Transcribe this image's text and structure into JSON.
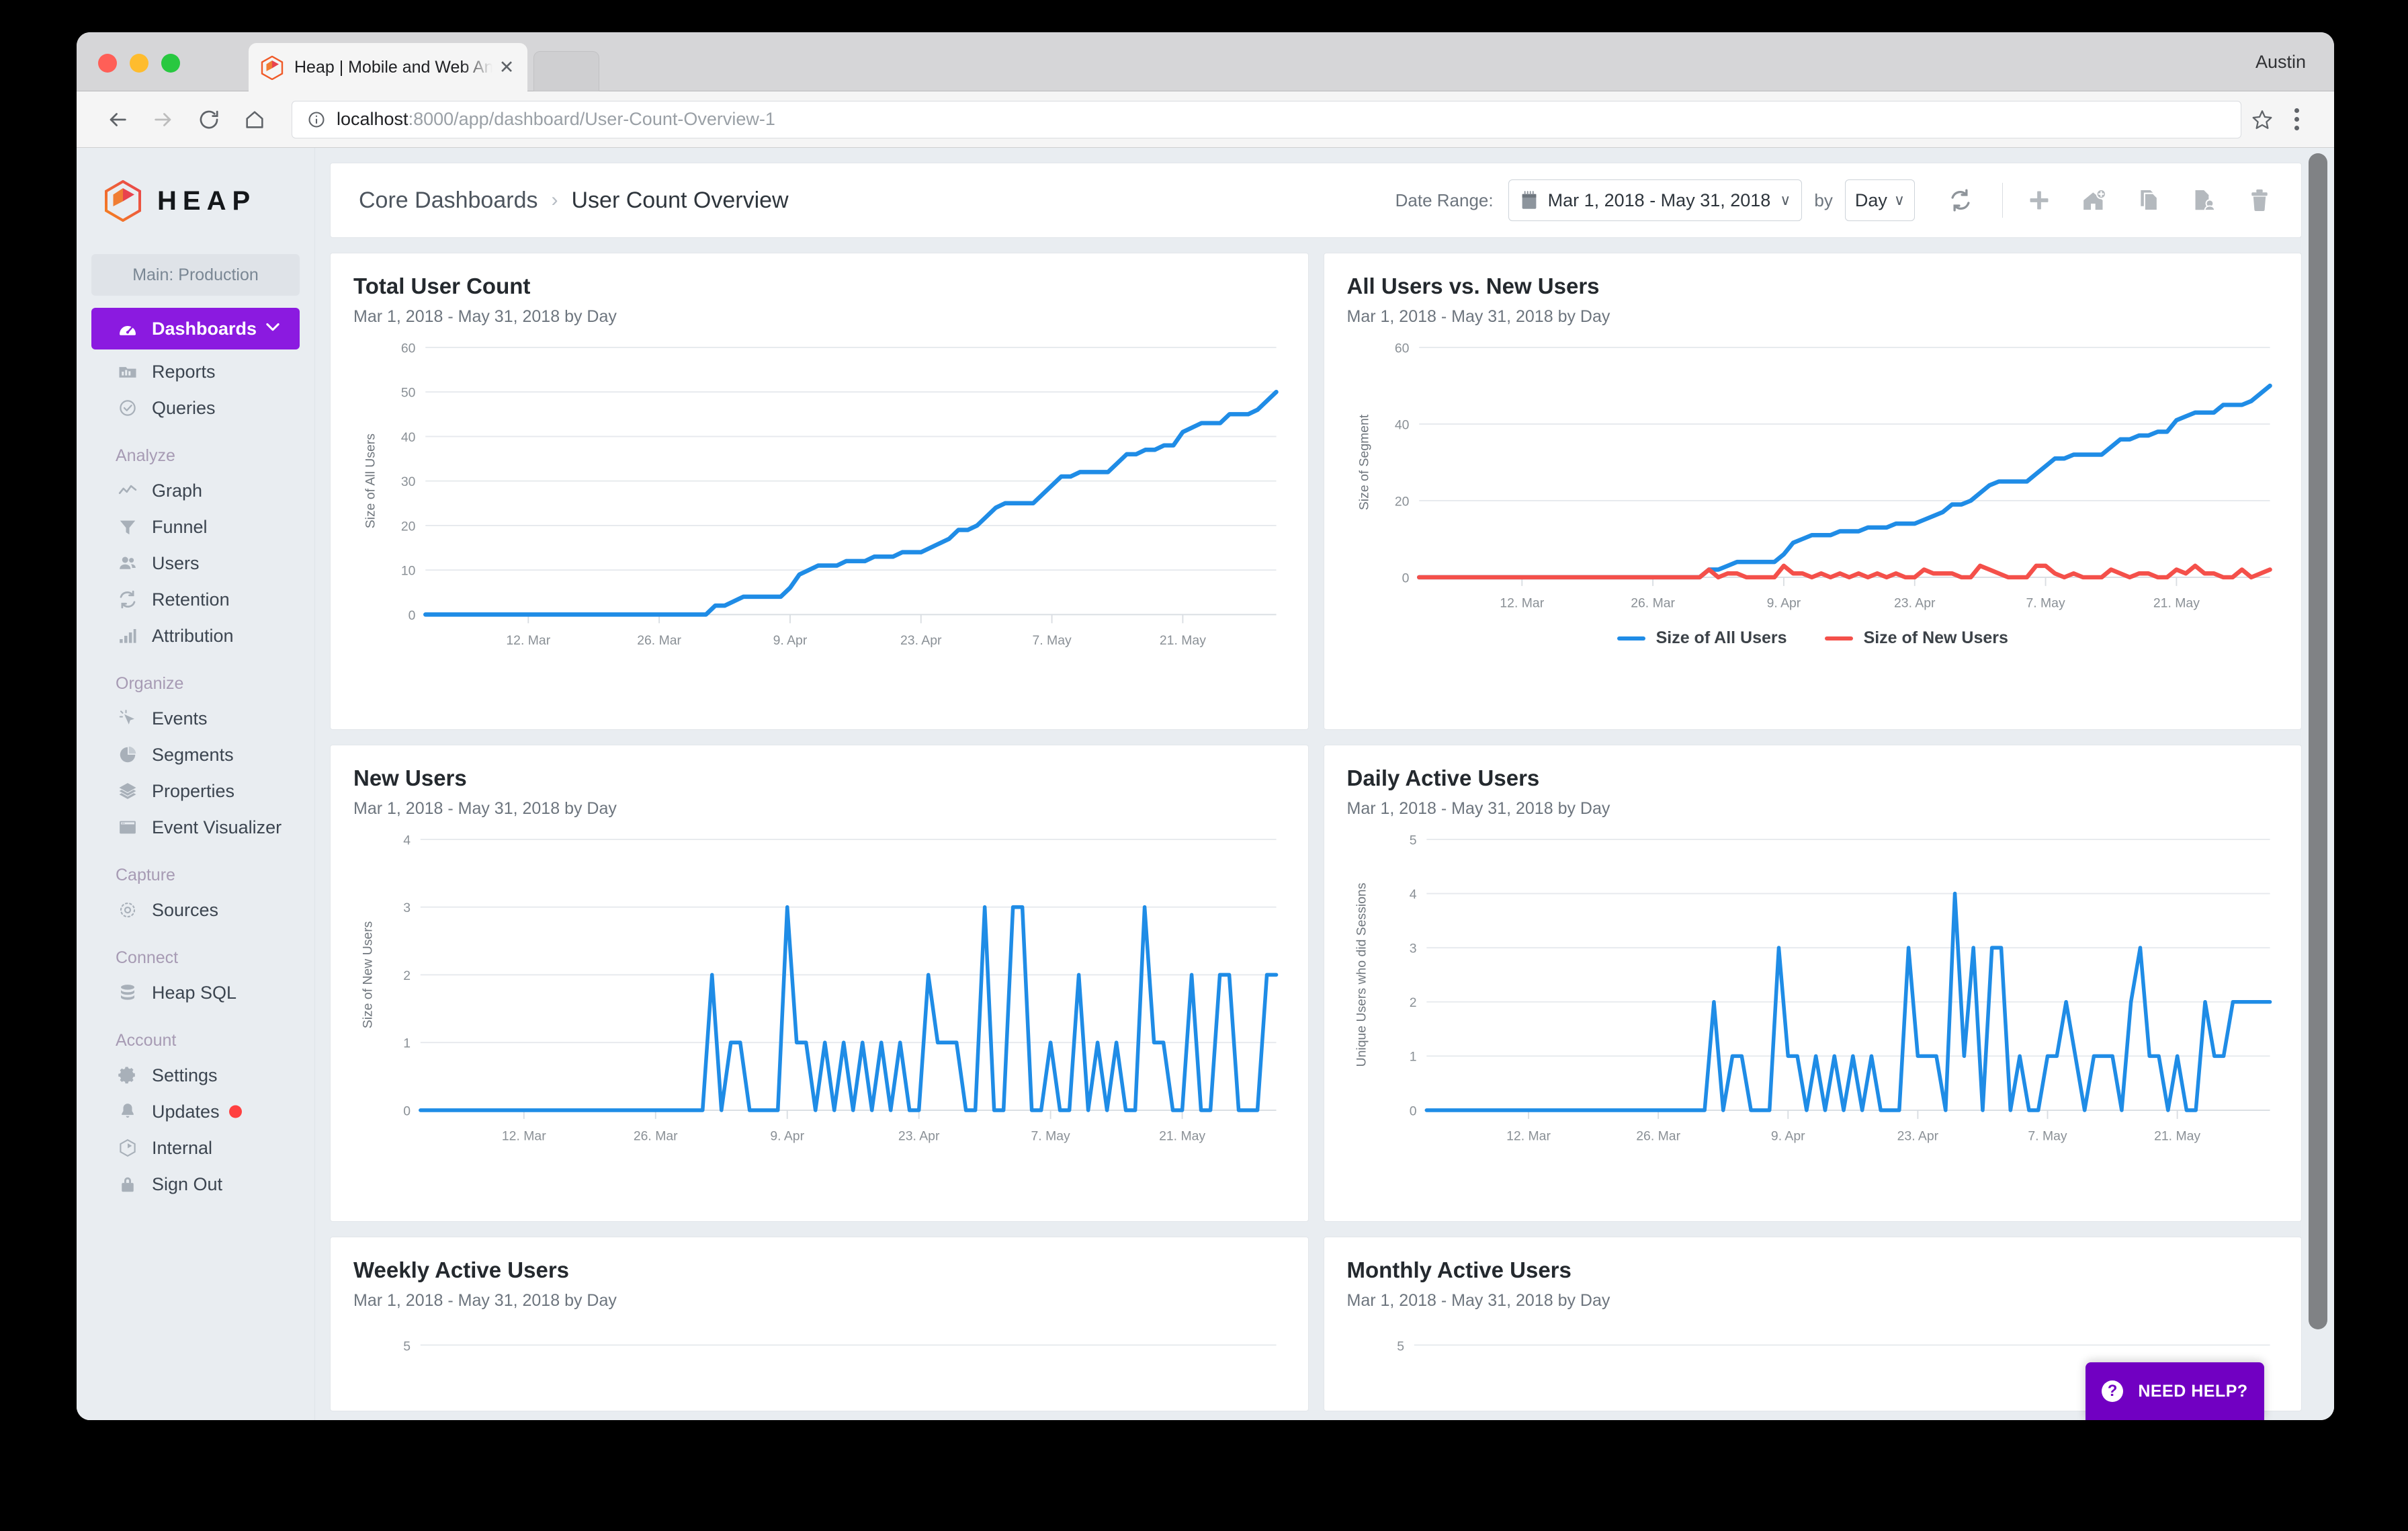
{
  "browser": {
    "tab_title": "Heap | Mobile and Web Analytics",
    "tab_close_label": "✕",
    "profile_name": "Austin",
    "url_host": "localhost",
    "url_path": ":8000/app/dashboard/User-Count-Overview-1",
    "back_label": "←",
    "forward_label": "→",
    "reload_label": "⟳",
    "home_label": "⌂"
  },
  "sidebar": {
    "brand": "HEAP",
    "environment": "Main: Production",
    "items": [
      {
        "label": "Dashboards",
        "icon": "dashboard-icon",
        "active": true
      },
      {
        "label": "Reports",
        "icon": "reports-icon",
        "active": false
      },
      {
        "label": "Queries",
        "icon": "queries-icon",
        "active": false
      }
    ],
    "groups": [
      {
        "label": "Analyze",
        "items": [
          {
            "label": "Graph",
            "icon": "graph-icon"
          },
          {
            "label": "Funnel",
            "icon": "funnel-icon"
          },
          {
            "label": "Users",
            "icon": "users-icon"
          },
          {
            "label": "Retention",
            "icon": "retention-icon"
          },
          {
            "label": "Attribution",
            "icon": "attribution-icon"
          }
        ]
      },
      {
        "label": "Organize",
        "items": [
          {
            "label": "Events",
            "icon": "events-icon"
          },
          {
            "label": "Segments",
            "icon": "segments-icon"
          },
          {
            "label": "Properties",
            "icon": "properties-icon"
          },
          {
            "label": "Event Visualizer",
            "icon": "event-visualizer-icon"
          }
        ]
      },
      {
        "label": "Capture",
        "items": [
          {
            "label": "Sources",
            "icon": "sources-icon"
          }
        ]
      },
      {
        "label": "Connect",
        "items": [
          {
            "label": "Heap SQL",
            "icon": "database-icon"
          }
        ]
      },
      {
        "label": "Account",
        "items": [
          {
            "label": "Settings",
            "icon": "gear-icon"
          },
          {
            "label": "Updates",
            "icon": "bell-icon",
            "badge": true
          },
          {
            "label": "Internal",
            "icon": "hexagon-icon"
          },
          {
            "label": "Sign Out",
            "icon": "lock-icon"
          }
        ]
      }
    ]
  },
  "header": {
    "breadcrumb_root": "Core Dashboards",
    "breadcrumb_separator": "›",
    "breadcrumb_current": "User Count Overview",
    "date_range_label": "Date Range:",
    "date_range_value": "Mar 1, 2018 - May 31, 2018",
    "by_label": "by",
    "interval_value": "Day",
    "chevron": "∨",
    "tools": [
      {
        "name": "refresh-icon"
      },
      {
        "name": "add-icon"
      },
      {
        "name": "add-home-icon"
      },
      {
        "name": "duplicate-icon"
      },
      {
        "name": "share-icon"
      },
      {
        "name": "trash-icon"
      }
    ]
  },
  "need_help": {
    "label": "NEED HELP?",
    "icon": "question-icon"
  },
  "colors": {
    "accent_purple": "#8b1ae0",
    "help_purple": "#7100c2",
    "series_blue": "#1f8ce6",
    "series_red": "#f4504a",
    "badge_red": "#ff4040"
  },
  "chart_data": [
    {
      "id": "total-user-count",
      "type": "line",
      "title": "Total User Count",
      "subtitle": "Mar 1, 2018 - May 31, 2018 by Day",
      "xlabel": "",
      "ylabel": "Size of All Users",
      "ylim": [
        0,
        60
      ],
      "yticks": [
        0,
        10,
        20,
        30,
        40,
        50,
        60
      ],
      "xticks": [
        "12. Mar",
        "26. Mar",
        "9. Apr",
        "23. Apr",
        "7. May",
        "21. May"
      ],
      "xtick_positions": [
        11,
        25,
        39,
        53,
        67,
        81
      ],
      "grid": true,
      "legend": false,
      "x_count": 92,
      "series": [
        {
          "name": "Size of All Users",
          "color": "#1f8ce6",
          "values": [
            0,
            0,
            0,
            0,
            0,
            0,
            0,
            0,
            0,
            0,
            0,
            0,
            0,
            0,
            0,
            0,
            0,
            0,
            0,
            0,
            0,
            0,
            0,
            0,
            0,
            0,
            0,
            0,
            0,
            0,
            0,
            2,
            2,
            3,
            4,
            4,
            4,
            4,
            4,
            6,
            9,
            10,
            11,
            11,
            11,
            12,
            12,
            12,
            13,
            13,
            13,
            14,
            14,
            14,
            15,
            16,
            17,
            19,
            19,
            20,
            22,
            24,
            25,
            25,
            25,
            25,
            27,
            29,
            31,
            31,
            32,
            32,
            32,
            32,
            34,
            36,
            36,
            37,
            37,
            38,
            38,
            41,
            42,
            43,
            43,
            43,
            45,
            45,
            45,
            46,
            48,
            50
          ]
        }
      ]
    },
    {
      "id": "all-users-vs-new-users",
      "type": "line",
      "title": "All Users vs. New Users",
      "subtitle": "Mar 1, 2018 - May 31, 2018 by Day",
      "xlabel": "",
      "ylabel": "Size of Segment",
      "ylim": [
        0,
        60
      ],
      "yticks": [
        0,
        20,
        40,
        60
      ],
      "xticks": [
        "12. Mar",
        "26. Mar",
        "9. Apr",
        "23. Apr",
        "7. May",
        "21. May"
      ],
      "xtick_positions": [
        11,
        25,
        39,
        53,
        67,
        81
      ],
      "grid": true,
      "legend": true,
      "legend_position": "bottom",
      "x_count": 92,
      "series": [
        {
          "name": "Size of All Users",
          "color": "#1f8ce6",
          "values": [
            0,
            0,
            0,
            0,
            0,
            0,
            0,
            0,
            0,
            0,
            0,
            0,
            0,
            0,
            0,
            0,
            0,
            0,
            0,
            0,
            0,
            0,
            0,
            0,
            0,
            0,
            0,
            0,
            0,
            0,
            0,
            2,
            2,
            3,
            4,
            4,
            4,
            4,
            4,
            6,
            9,
            10,
            11,
            11,
            11,
            12,
            12,
            12,
            13,
            13,
            13,
            14,
            14,
            14,
            15,
            16,
            17,
            19,
            19,
            20,
            22,
            24,
            25,
            25,
            25,
            25,
            27,
            29,
            31,
            31,
            32,
            32,
            32,
            32,
            34,
            36,
            36,
            37,
            37,
            38,
            38,
            41,
            42,
            43,
            43,
            43,
            45,
            45,
            45,
            46,
            48,
            50
          ]
        },
        {
          "name": "Size of New Users",
          "color": "#f4504a",
          "values": [
            0,
            0,
            0,
            0,
            0,
            0,
            0,
            0,
            0,
            0,
            0,
            0,
            0,
            0,
            0,
            0,
            0,
            0,
            0,
            0,
            0,
            0,
            0,
            0,
            0,
            0,
            0,
            0,
            0,
            0,
            0,
            2,
            0,
            1,
            1,
            0,
            0,
            0,
            0,
            3,
            1,
            1,
            0,
            1,
            0,
            1,
            0,
            1,
            0,
            1,
            0,
            1,
            0,
            0,
            2,
            1,
            1,
            1,
            0,
            0,
            3,
            2,
            1,
            0,
            0,
            0,
            3,
            3,
            1,
            0,
            1,
            0,
            0,
            0,
            2,
            1,
            0,
            1,
            1,
            0,
            0,
            2,
            1,
            3,
            1,
            1,
            0,
            0,
            2,
            0,
            1,
            2
          ]
        }
      ]
    },
    {
      "id": "new-users",
      "type": "line",
      "title": "New Users",
      "subtitle": "Mar 1, 2018 - May 31, 2018 by Day",
      "xlabel": "",
      "ylabel": "Size of New Users",
      "ylim": [
        0,
        4
      ],
      "yticks": [
        0,
        1,
        2,
        3,
        4
      ],
      "xticks": [
        "12. Mar",
        "26. Mar",
        "9. Apr",
        "23. Apr",
        "7. May",
        "21. May"
      ],
      "xtick_positions": [
        11,
        25,
        39,
        53,
        67,
        81
      ],
      "grid": true,
      "legend": false,
      "x_count": 92,
      "series": [
        {
          "name": "Size of New Users",
          "color": "#1f8ce6",
          "values": [
            0,
            0,
            0,
            0,
            0,
            0,
            0,
            0,
            0,
            0,
            0,
            0,
            0,
            0,
            0,
            0,
            0,
            0,
            0,
            0,
            0,
            0,
            0,
            0,
            0,
            0,
            0,
            0,
            0,
            0,
            0,
            2,
            0,
            1,
            1,
            0,
            0,
            0,
            0,
            3,
            1,
            1,
            0,
            1,
            0,
            1,
            0,
            1,
            0,
            1,
            0,
            1,
            0,
            0,
            2,
            1,
            1,
            1,
            0,
            0,
            3,
            0,
            0,
            3,
            3,
            0,
            0,
            1,
            0,
            0,
            2,
            0,
            1,
            0,
            1,
            0,
            0,
            3,
            1,
            1,
            0,
            0,
            2,
            0,
            0,
            2,
            2,
            0,
            0,
            0,
            2,
            2
          ]
        }
      ]
    },
    {
      "id": "daily-active-users",
      "type": "line",
      "title": "Daily Active Users",
      "subtitle": "Mar 1, 2018 - May 31, 2018 by Day",
      "xlabel": "",
      "ylabel": "Unique Users who did Sessions",
      "ylim": [
        0,
        5
      ],
      "yticks": [
        0,
        1,
        2,
        3,
        4,
        5
      ],
      "xticks": [
        "12. Mar",
        "26. Mar",
        "9. Apr",
        "23. Apr",
        "7. May",
        "21. May"
      ],
      "xtick_positions": [
        11,
        25,
        39,
        53,
        67,
        81
      ],
      "grid": true,
      "legend": false,
      "x_count": 92,
      "series": [
        {
          "name": "Unique Users who did Sessions",
          "color": "#1f8ce6",
          "values": [
            0,
            0,
            0,
            0,
            0,
            0,
            0,
            0,
            0,
            0,
            0,
            0,
            0,
            0,
            0,
            0,
            0,
            0,
            0,
            0,
            0,
            0,
            0,
            0,
            0,
            0,
            0,
            0,
            0,
            0,
            0,
            2,
            0,
            1,
            1,
            0,
            0,
            0,
            3,
            1,
            1,
            0,
            1,
            0,
            1,
            0,
            1,
            0,
            1,
            0,
            0,
            0,
            3,
            1,
            1,
            1,
            0,
            4,
            1,
            3,
            0,
            3,
            3,
            0,
            1,
            0,
            0,
            1,
            1,
            2,
            1,
            0,
            1,
            1,
            1,
            0,
            2,
            3,
            1,
            1,
            0,
            1,
            0,
            0,
            2,
            1,
            1,
            2,
            2,
            2,
            2,
            2
          ]
        }
      ]
    },
    {
      "id": "weekly-active-users",
      "type": "line",
      "title": "Weekly Active Users",
      "subtitle": "Mar 1, 2018 - May 31, 2018 by Day",
      "ylim": [
        0,
        5
      ],
      "yticks": [
        5
      ],
      "grid": true,
      "legend": false,
      "partial": true,
      "series": []
    },
    {
      "id": "monthly-active-users",
      "type": "line",
      "title": "Monthly Active Users",
      "subtitle": "Mar 1, 2018 - May 31, 2018 by Day",
      "ylim": [
        0,
        5
      ],
      "yticks": [
        5
      ],
      "grid": true,
      "legend": false,
      "partial": true,
      "series": []
    }
  ]
}
